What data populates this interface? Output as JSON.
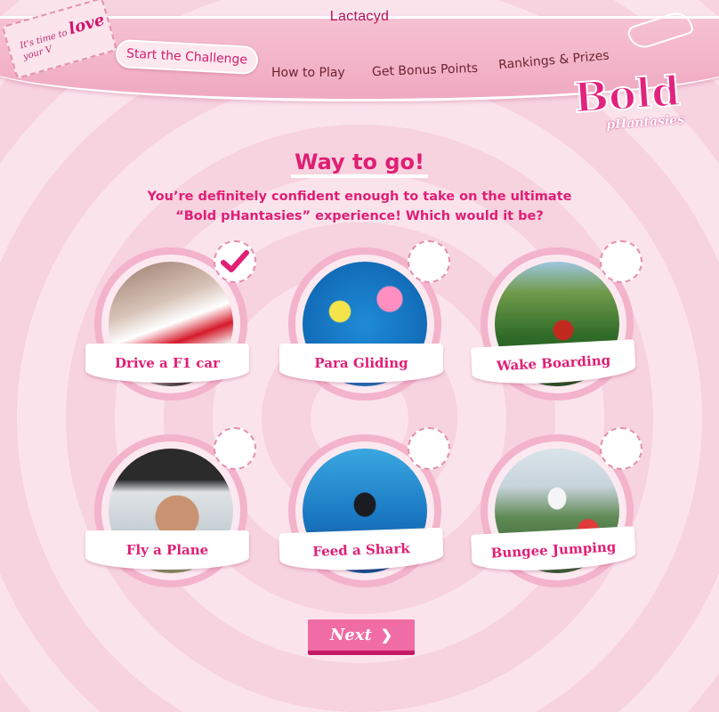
{
  "header": {
    "brand": "Lactacyd",
    "ticket_prefix": "It's time to",
    "ticket_love": "love",
    "ticket_suffix": "your V",
    "nav": [
      "Start the Challenge",
      "How to Play",
      "Get Bonus Points",
      "Rankings & Prizes"
    ],
    "active_index": 0
  },
  "logo": {
    "big": "Bold",
    "small": "pHantasies"
  },
  "main": {
    "title": "Way to go!",
    "subtitle_line1": "You’re definitely confident enough to take on the ultimate",
    "subtitle_line2": "“Bold pHantasies” experience! Which would it be?"
  },
  "options": [
    {
      "label": "Drive a F1 car",
      "selected": true
    },
    {
      "label": "Para Gliding",
      "selected": false
    },
    {
      "label": "Wake Boarding",
      "selected": false
    },
    {
      "label": "Fly a Plane",
      "selected": false
    },
    {
      "label": "Feed a Shark",
      "selected": false
    },
    {
      "label": "Bungee Jumping",
      "selected": false
    }
  ],
  "next_button": {
    "label": "Next"
  },
  "colors": {
    "accent": "#e01e74",
    "button": "#f06ca4",
    "ring": "#f3b3ca"
  }
}
